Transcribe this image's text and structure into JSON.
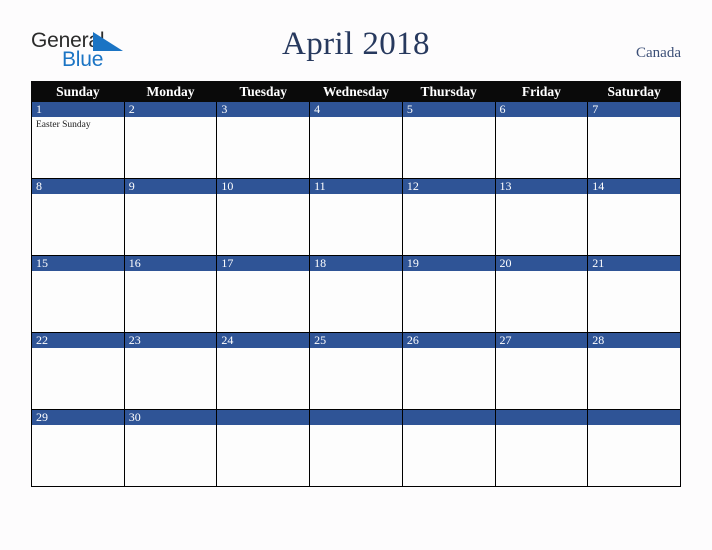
{
  "logo": {
    "word_one": "General",
    "word_two": "Blue",
    "triangle_color": "#1b74c4",
    "word_one_color": "#2b2b2b",
    "word_two_color": "#1b74c4"
  },
  "header": {
    "title": "April 2018",
    "title_color": "#27395e",
    "country": "Canada",
    "country_color": "#3c4f77"
  },
  "calendar": {
    "header_background": "#0a0a0a",
    "header_text_color": "#ffffff",
    "daynum_background": "#2f5496",
    "daynum_text_color": "#ffffff",
    "cell_background": "#fdfdfd",
    "border_color": "#000000",
    "weekday_headers": [
      "Sunday",
      "Monday",
      "Tuesday",
      "Wednesday",
      "Thursday",
      "Friday",
      "Saturday"
    ],
    "weeks": [
      [
        {
          "day": "1",
          "events": [
            "Easter Sunday"
          ]
        },
        {
          "day": "2",
          "events": []
        },
        {
          "day": "3",
          "events": []
        },
        {
          "day": "4",
          "events": []
        },
        {
          "day": "5",
          "events": []
        },
        {
          "day": "6",
          "events": []
        },
        {
          "day": "7",
          "events": []
        }
      ],
      [
        {
          "day": "8",
          "events": []
        },
        {
          "day": "9",
          "events": []
        },
        {
          "day": "10",
          "events": []
        },
        {
          "day": "11",
          "events": []
        },
        {
          "day": "12",
          "events": []
        },
        {
          "day": "13",
          "events": []
        },
        {
          "day": "14",
          "events": []
        }
      ],
      [
        {
          "day": "15",
          "events": []
        },
        {
          "day": "16",
          "events": []
        },
        {
          "day": "17",
          "events": []
        },
        {
          "day": "18",
          "events": []
        },
        {
          "day": "19",
          "events": []
        },
        {
          "day": "20",
          "events": []
        },
        {
          "day": "21",
          "events": []
        }
      ],
      [
        {
          "day": "22",
          "events": []
        },
        {
          "day": "23",
          "events": []
        },
        {
          "day": "24",
          "events": []
        },
        {
          "day": "25",
          "events": []
        },
        {
          "day": "26",
          "events": []
        },
        {
          "day": "27",
          "events": []
        },
        {
          "day": "28",
          "events": []
        }
      ],
      [
        {
          "day": "29",
          "events": []
        },
        {
          "day": "30",
          "events": []
        },
        {
          "day": "",
          "events": []
        },
        {
          "day": "",
          "events": []
        },
        {
          "day": "",
          "events": []
        },
        {
          "day": "",
          "events": []
        },
        {
          "day": "",
          "events": []
        }
      ]
    ]
  }
}
